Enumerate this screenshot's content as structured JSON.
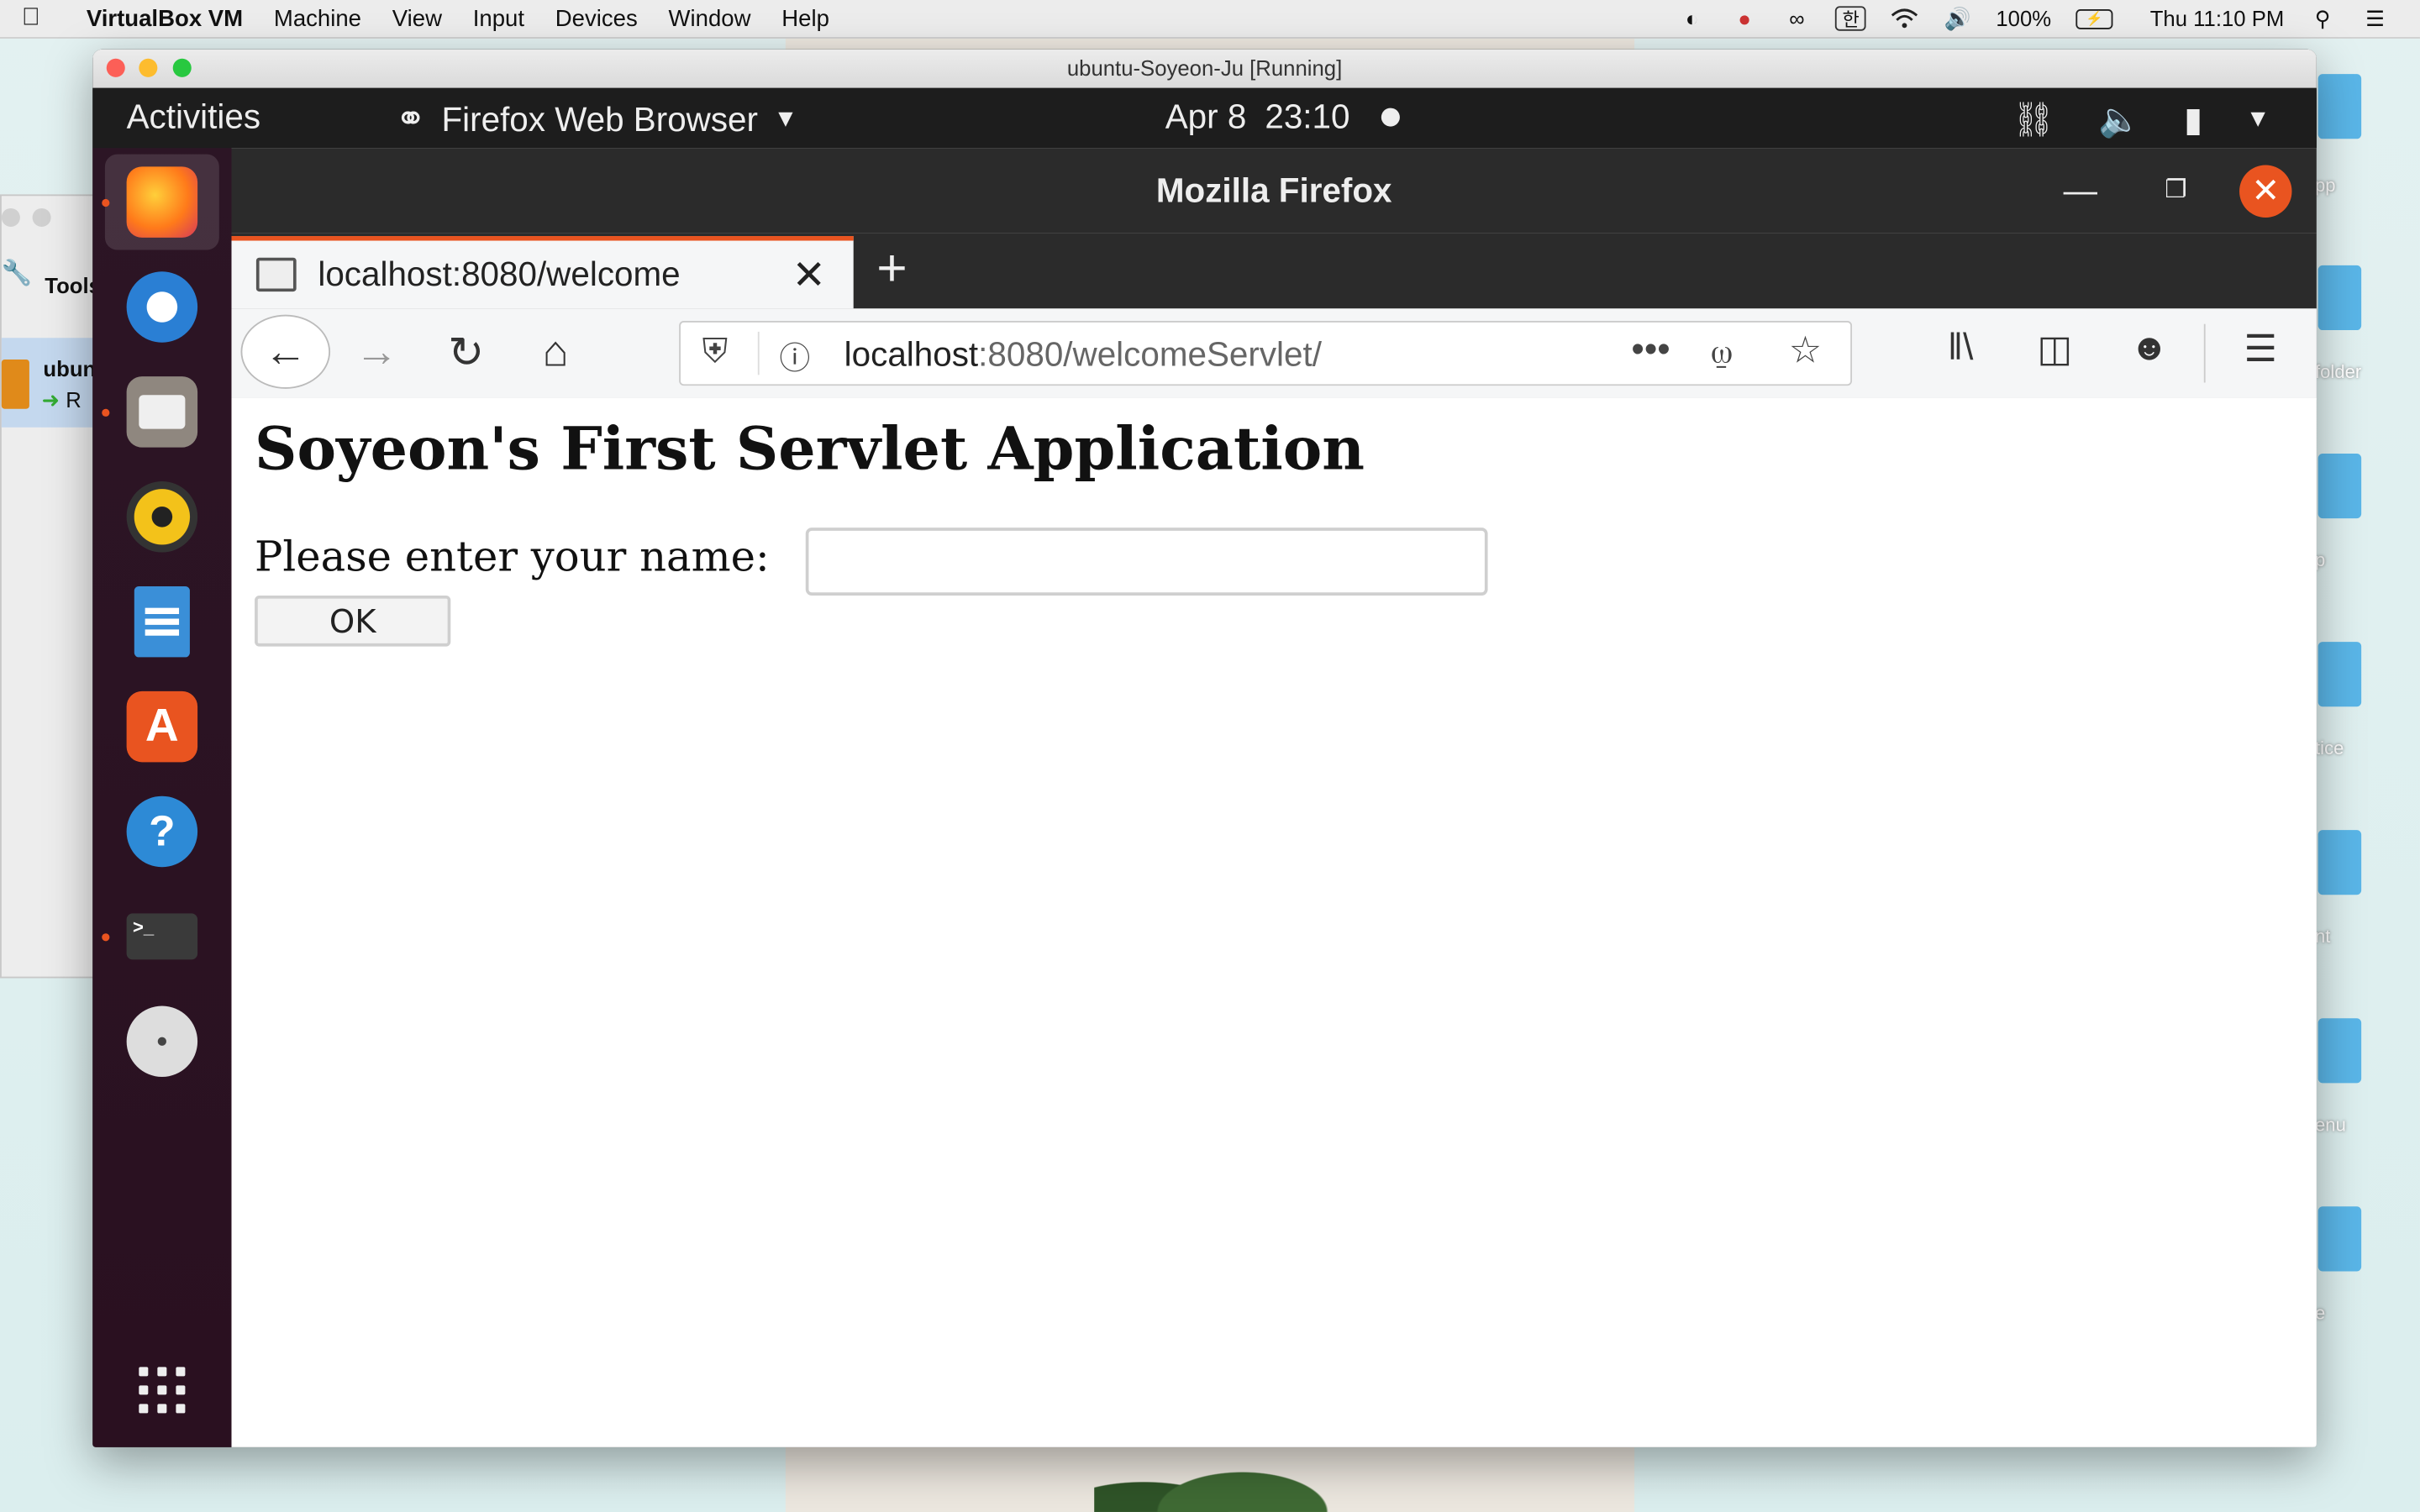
{
  "mac_menubar": {
    "app_name": "VirtualBox VM",
    "menus": [
      "Machine",
      "View",
      "Input",
      "Devices",
      "Window",
      "Help"
    ],
    "battery": "100%",
    "clock": "Thu 11:10 PM",
    "input_source": "한"
  },
  "desktop_labels": [
    "pp",
    "folder",
    "p",
    "tice",
    "nt",
    "enu",
    "e"
  ],
  "vbox_manager": {
    "tools_label": "Tools",
    "vm_name": "ubun",
    "vm_state": "R"
  },
  "vm_window": {
    "title": "ubuntu-Soyeon-Ju [Running]"
  },
  "ubuntu_topbar": {
    "activities": "Activities",
    "app_menu": "Firefox Web Browser",
    "date": "Apr 8",
    "time": "23:10"
  },
  "firefox": {
    "window_title": "Mozilla Firefox",
    "tab_title": "localhost:8080/welcome",
    "url_host": "localhost",
    "url_path": ":8080/welcomeServlet/",
    "new_tab": "+"
  },
  "page": {
    "heading": "Soyeon's First Servlet Application",
    "name_label": "Please enter your name:",
    "name_value": "",
    "ok_button": "OK"
  },
  "colors": {
    "ubuntu_accent": "#e95420",
    "dock_bg": "#2c1525",
    "topbar_bg": "#1d1d1d"
  }
}
